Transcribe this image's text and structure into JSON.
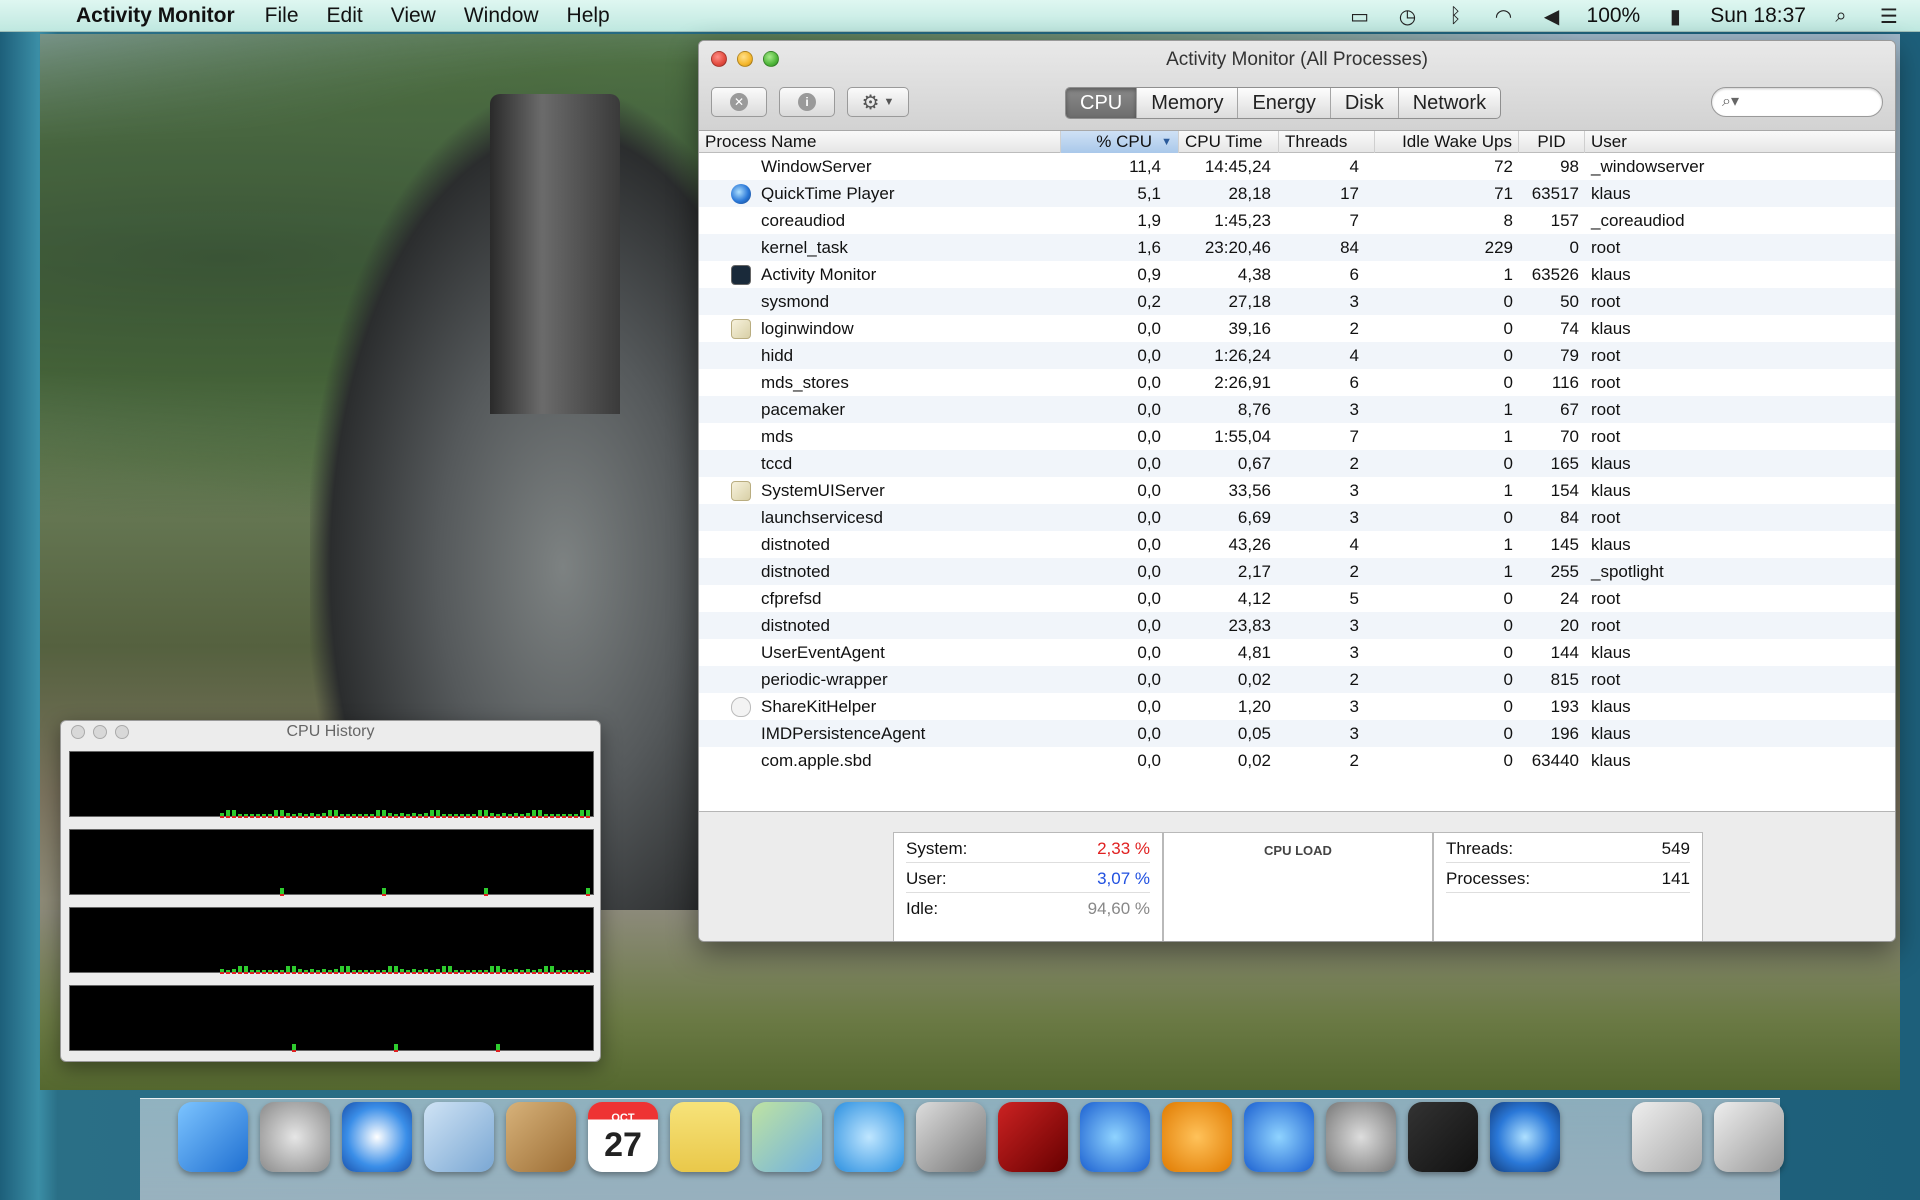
{
  "menubar": {
    "app_name": "Activity Monitor",
    "menus": [
      "File",
      "Edit",
      "View",
      "Window",
      "Help"
    ],
    "battery": "100%",
    "clock": "Sun 18:37"
  },
  "window": {
    "title": "Activity Monitor (All Processes)",
    "tabs": [
      "CPU",
      "Memory",
      "Energy",
      "Disk",
      "Network"
    ],
    "active_tab": "CPU",
    "search_placeholder": ""
  },
  "table": {
    "columns": [
      "Process Name",
      "% CPU",
      "CPU Time",
      "Threads",
      "Idle Wake Ups",
      "PID",
      "User"
    ],
    "sorted_column": "% CPU",
    "rows": [
      {
        "name": "WindowServer",
        "icon": "none",
        "cpu": "11,4",
        "time": "14:45,24",
        "threads": "4",
        "idle": "72",
        "pid": "98",
        "user": "_windowserver"
      },
      {
        "name": "QuickTime Player",
        "icon": "quicktime-icon",
        "cpu": "5,1",
        "time": "28,18",
        "threads": "17",
        "idle": "71",
        "pid": "63517",
        "user": "klaus"
      },
      {
        "name": "coreaudiod",
        "icon": "none",
        "cpu": "1,9",
        "time": "1:45,23",
        "threads": "7",
        "idle": "8",
        "pid": "157",
        "user": "_coreaudiod"
      },
      {
        "name": "kernel_task",
        "icon": "none",
        "cpu": "1,6",
        "time": "23:20,46",
        "threads": "84",
        "idle": "229",
        "pid": "0",
        "user": "root"
      },
      {
        "name": "Activity Monitor",
        "icon": "activity-monitor-icon",
        "cpu": "0,9",
        "time": "4,38",
        "threads": "6",
        "idle": "1",
        "pid": "63526",
        "user": "klaus"
      },
      {
        "name": "sysmond",
        "icon": "none",
        "cpu": "0,2",
        "time": "27,18",
        "threads": "3",
        "idle": "0",
        "pid": "50",
        "user": "root"
      },
      {
        "name": "loginwindow",
        "icon": "loginwindow-icon",
        "cpu": "0,0",
        "time": "39,16",
        "threads": "2",
        "idle": "0",
        "pid": "74",
        "user": "klaus"
      },
      {
        "name": "hidd",
        "icon": "none",
        "cpu": "0,0",
        "time": "1:26,24",
        "threads": "4",
        "idle": "0",
        "pid": "79",
        "user": "root"
      },
      {
        "name": "mds_stores",
        "icon": "none",
        "cpu": "0,0",
        "time": "2:26,91",
        "threads": "6",
        "idle": "0",
        "pid": "116",
        "user": "root"
      },
      {
        "name": "pacemaker",
        "icon": "none",
        "cpu": "0,0",
        "time": "8,76",
        "threads": "3",
        "idle": "1",
        "pid": "67",
        "user": "root"
      },
      {
        "name": "mds",
        "icon": "none",
        "cpu": "0,0",
        "time": "1:55,04",
        "threads": "7",
        "idle": "1",
        "pid": "70",
        "user": "root"
      },
      {
        "name": "tccd",
        "icon": "none",
        "cpu": "0,0",
        "time": "0,67",
        "threads": "2",
        "idle": "0",
        "pid": "165",
        "user": "klaus"
      },
      {
        "name": "SystemUIServer",
        "icon": "systemuiserver-icon",
        "cpu": "0,0",
        "time": "33,56",
        "threads": "3",
        "idle": "1",
        "pid": "154",
        "user": "klaus"
      },
      {
        "name": "launchservicesd",
        "icon": "none",
        "cpu": "0,0",
        "time": "6,69",
        "threads": "3",
        "idle": "0",
        "pid": "84",
        "user": "root"
      },
      {
        "name": "distnoted",
        "icon": "none",
        "cpu": "0,0",
        "time": "43,26",
        "threads": "4",
        "idle": "1",
        "pid": "145",
        "user": "klaus"
      },
      {
        "name": "distnoted",
        "icon": "none",
        "cpu": "0,0",
        "time": "2,17",
        "threads": "2",
        "idle": "1",
        "pid": "255",
        "user": "_spotlight"
      },
      {
        "name": "cfprefsd",
        "icon": "none",
        "cpu": "0,0",
        "time": "4,12",
        "threads": "5",
        "idle": "0",
        "pid": "24",
        "user": "root"
      },
      {
        "name": "distnoted",
        "icon": "none",
        "cpu": "0,0",
        "time": "23,83",
        "threads": "3",
        "idle": "0",
        "pid": "20",
        "user": "root"
      },
      {
        "name": "UserEventAgent",
        "icon": "none",
        "cpu": "0,0",
        "time": "4,81",
        "threads": "3",
        "idle": "0",
        "pid": "144",
        "user": "klaus"
      },
      {
        "name": "periodic-wrapper",
        "icon": "none",
        "cpu": "0,0",
        "time": "0,02",
        "threads": "2",
        "idle": "0",
        "pid": "815",
        "user": "root"
      },
      {
        "name": "ShareKitHelper",
        "icon": "sharekit-icon",
        "cpu": "0,0",
        "time": "1,20",
        "threads": "3",
        "idle": "0",
        "pid": "193",
        "user": "klaus"
      },
      {
        "name": "IMDPersistenceAgent",
        "icon": "none",
        "cpu": "0,0",
        "time": "0,05",
        "threads": "3",
        "idle": "0",
        "pid": "196",
        "user": "klaus"
      },
      {
        "name": "com.apple.sbd",
        "icon": "none",
        "cpu": "0,0",
        "time": "0,02",
        "threads": "2",
        "idle": "0",
        "pid": "63440",
        "user": "klaus"
      }
    ]
  },
  "stats": {
    "system_label": "System:",
    "system_value": "2,33 %",
    "user_label": "User:",
    "user_value": "3,07 %",
    "idle_label": "Idle:",
    "idle_value": "94,60 %",
    "cpu_load_title": "CPU LOAD",
    "threads_label": "Threads:",
    "threads_value": "549",
    "processes_label": "Processes:",
    "processes_value": "141",
    "colors": {
      "system": "#e02020",
      "user": "#2050e0",
      "idle": "#888888"
    }
  },
  "cpu_history": {
    "title": "CPU History",
    "cores": 4
  },
  "dock": {
    "apps": [
      "finder-icon",
      "launchpad-icon",
      "safari-icon",
      "mail-icon",
      "contacts-icon",
      "calendar-icon",
      "notes-icon",
      "maps-icon",
      "messages-icon",
      "facetime-icon",
      "photo-booth-icon",
      "itunes-icon",
      "ibooks-icon",
      "app-store-icon",
      "system-preferences-icon",
      "activity-monitor-dock-icon",
      "quicktime-dock-icon",
      "downloads-icon",
      "trash-icon"
    ],
    "calendar_month": "OCT",
    "calendar_day": "27"
  }
}
